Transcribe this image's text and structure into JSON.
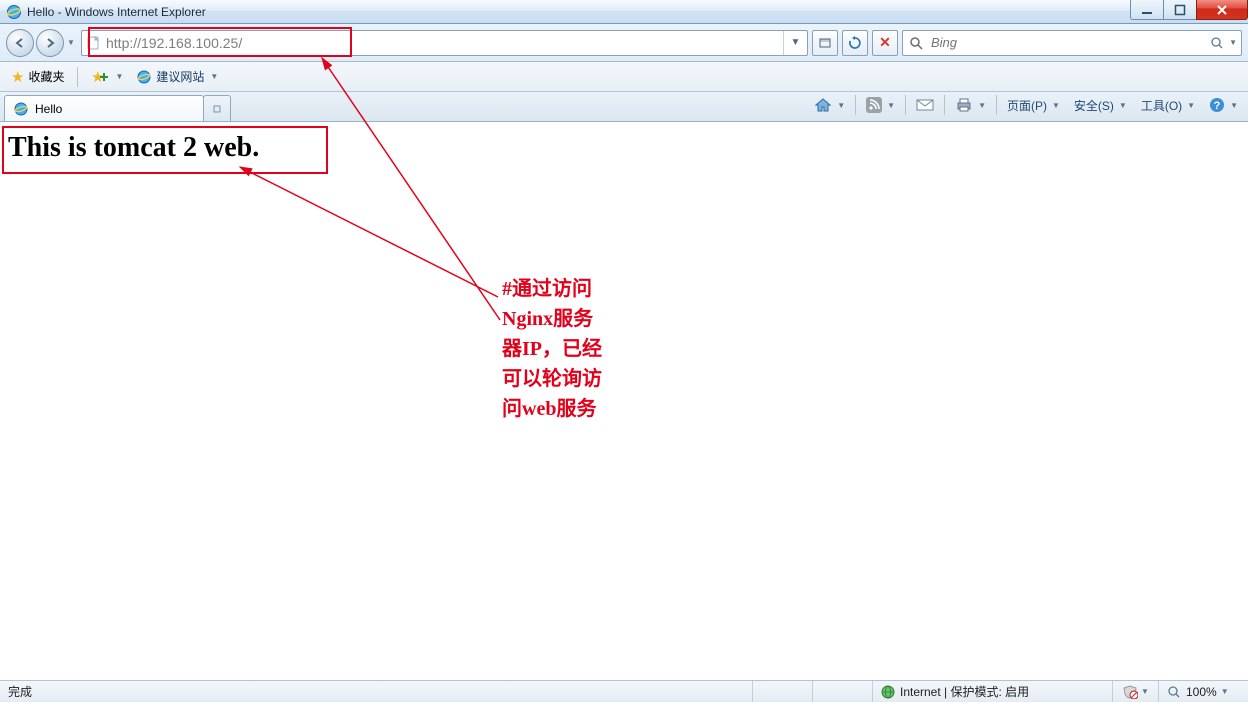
{
  "window_title": "Hello - Windows Internet Explorer",
  "nav": {
    "url": "http://192.168.100.25/",
    "back_label": "back",
    "forward_label": "forward"
  },
  "search": {
    "placeholder": "Bing"
  },
  "favorites": {
    "label": "收藏夹",
    "suggested": "建议网站"
  },
  "tab": {
    "title": "Hello"
  },
  "commandbar": {
    "page": "页面(P)",
    "safety": "安全(S)",
    "tools": "工具(O)"
  },
  "page": {
    "heading": "This is tomcat 2 web."
  },
  "annotation": {
    "text_l1": "#通过访问",
    "text_l2": "Nginx服务",
    "text_l3": "器IP，已经",
    "text_l4": "可以轮询访",
    "text_l5": "问web服务"
  },
  "status": {
    "done": "完成",
    "zone": "Internet | 保护模式: 启用",
    "zoom": "100%"
  }
}
